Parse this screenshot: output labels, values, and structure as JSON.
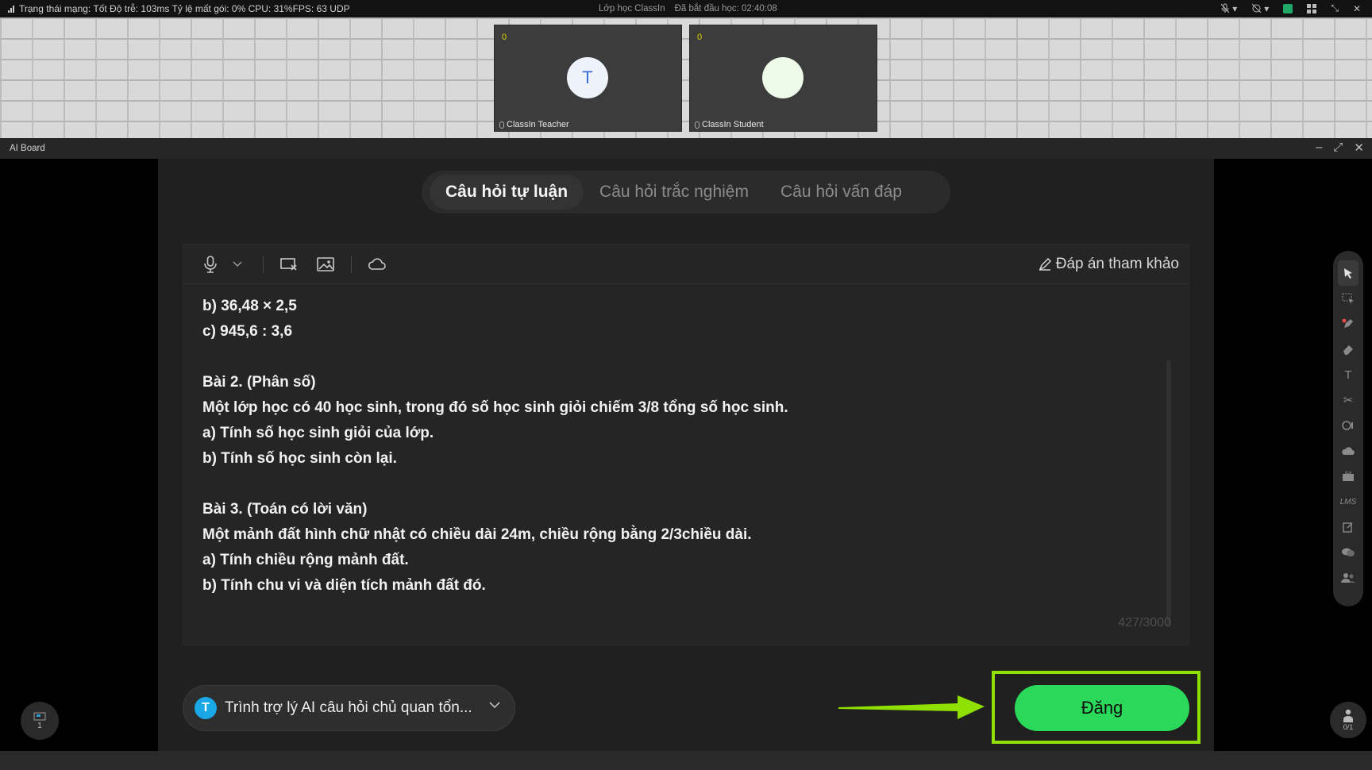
{
  "topbar": {
    "network_status": "Trạng thái mạng: Tốt Độ trễ: 103ms Tỷ lệ mất gói: 0%  CPU: 31%FPS: 63 UDP",
    "class_name": "Lớp học ClassIn",
    "elapsed": "Đã bắt đầu học: 02:40:08"
  },
  "videos": [
    {
      "count": "0",
      "avatar_letter": "T",
      "name": "ClassIn Teacher"
    },
    {
      "count": "0",
      "avatar_letter": "",
      "name": "ClassIn Student"
    }
  ],
  "board": {
    "title": "AI Board"
  },
  "tabs": [
    {
      "label": "Câu hỏi tự luận",
      "active": true
    },
    {
      "label": "Câu hỏi trắc nghiệm",
      "active": false
    },
    {
      "label": "Câu hỏi vấn đáp",
      "active": false
    }
  ],
  "editor": {
    "reference_label": "Đáp án tham khảo",
    "lines": [
      "b) 36,48 × 2,5",
      "c) 945,6 : 3,6",
      "",
      "Bài 2. (Phân số)",
      "Một lớp học có 40 học sinh, trong đó số học sinh giỏi chiếm 3/8 tổng số học sinh.",
      "a) Tính số học sinh giỏi của lớp.",
      "b) Tính số học sinh còn lại.",
      "",
      "Bài 3. (Toán có lời văn)",
      "Một mảnh đất hình chữ nhật có chiều dài 24m, chiều rộng bằng 2/3chiều dài.",
      "a) Tính chiều rộng mảnh đất.",
      "b) Tính chu vi và diện tích mảnh đất đó."
    ],
    "char_count": "427/3000"
  },
  "assistant": {
    "avatar_letter": "T",
    "label": "Trình trợ lý AI câu hỏi chủ quan tổn..."
  },
  "post_button": "Đăng",
  "rail_icons": [
    "cursor-icon",
    "selector-icon",
    "pen-icon",
    "eraser-icon",
    "text-icon",
    "scissors-icon",
    "shape-icon",
    "cloud-icon",
    "toolbox-icon",
    "lms-icon",
    "edit-icon",
    "chat-icon",
    "users-icon"
  ],
  "rail_lms_label": "LMS",
  "page_indicator": "1",
  "seat_indicator": "0/1",
  "colors": {
    "accent_green": "#2ad85a",
    "highlight_lime": "#8fe000",
    "assistant_blue": "#1aa7e6"
  }
}
